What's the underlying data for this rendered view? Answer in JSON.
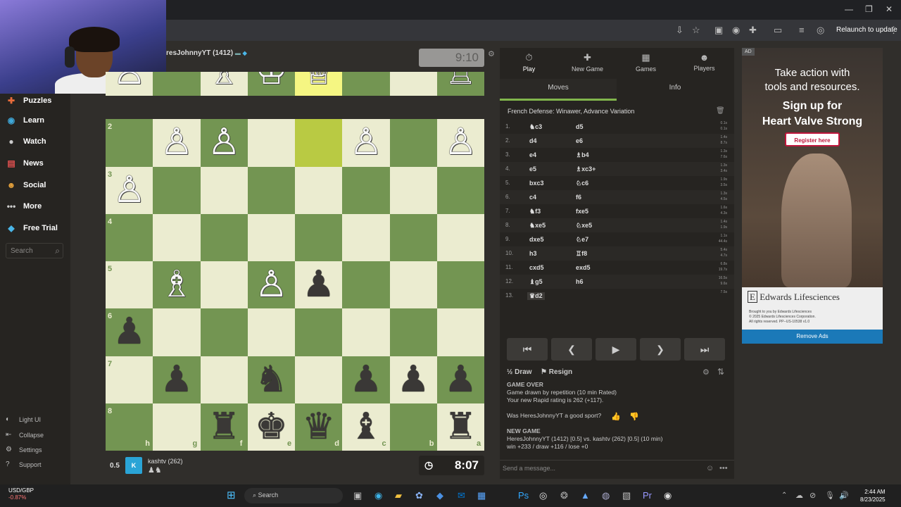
{
  "browser": {
    "relaunch_label": "Relaunch to update"
  },
  "sidebar": {
    "items": [
      {
        "icon": "puzzle-icon",
        "glyph": "✚",
        "label": "Puzzles",
        "color": "#e96c3b"
      },
      {
        "icon": "learn-icon",
        "glyph": "◉",
        "label": "Learn",
        "color": "#3fa8d9"
      },
      {
        "icon": "watch-icon",
        "glyph": "●",
        "label": "Watch",
        "color": "#cccccc"
      },
      {
        "icon": "news-icon",
        "glyph": "▤",
        "label": "News",
        "color": "#e0504f"
      },
      {
        "icon": "social-icon",
        "glyph": "☻",
        "label": "Social",
        "color": "#e6a23c"
      },
      {
        "icon": "more-icon",
        "glyph": "•••",
        "label": "More",
        "color": "#cccccc"
      },
      {
        "icon": "diamond-icon",
        "glyph": "◆",
        "label": "Free Trial",
        "color": "#4ab6e8"
      }
    ],
    "search_placeholder": "Search",
    "bottom": [
      {
        "glyph": "◐",
        "label": "Light UI"
      },
      {
        "glyph": "⇤",
        "label": "Collapse"
      },
      {
        "glyph": "⚙",
        "label": "Settings"
      },
      {
        "glyph": "?",
        "label": "Support"
      }
    ]
  },
  "top_player": {
    "name": "resJohnnyYT (1412)",
    "clock": "9:10"
  },
  "bottom_player": {
    "score": "0.5",
    "name": "kashtv (262)",
    "clock": "8:07",
    "avatar": "K"
  },
  "board": {
    "light": "#ebecd0",
    "dark": "#739552",
    "highlight": [
      [
        0,
        4
      ],
      [
        1,
        4
      ]
    ],
    "ranks": [
      "1",
      "2",
      "3",
      "4",
      "5",
      "6",
      "7",
      "8"
    ],
    "files": [
      "h",
      "g",
      "f",
      "e",
      "d",
      "c",
      "b",
      "a"
    ],
    "pieces": [
      {
        "r": 0,
        "c": 0,
        "p": "♙",
        "s": "w"
      },
      {
        "r": 0,
        "c": 2,
        "p": "♗",
        "s": "w"
      },
      {
        "r": 0,
        "c": 3,
        "p": "♔",
        "s": "w"
      },
      {
        "r": 0,
        "c": 4,
        "p": "♕",
        "s": "w"
      },
      {
        "r": 0,
        "c": 7,
        "p": "♖",
        "s": "w"
      },
      {
        "r": 1,
        "c": 1,
        "p": "♙",
        "s": "w"
      },
      {
        "r": 1,
        "c": 2,
        "p": "♙",
        "s": "w"
      },
      {
        "r": 1,
        "c": 5,
        "p": "♙",
        "s": "w"
      },
      {
        "r": 1,
        "c": 7,
        "p": "♙",
        "s": "w"
      },
      {
        "r": 2,
        "c": 0,
        "p": "♙",
        "s": "w"
      },
      {
        "r": 4,
        "c": 1,
        "p": "♗",
        "s": "w"
      },
      {
        "r": 4,
        "c": 3,
        "p": "♙",
        "s": "w"
      },
      {
        "r": 4,
        "c": 4,
        "p": "♟",
        "s": "b"
      },
      {
        "r": 5,
        "c": 0,
        "p": "♟",
        "s": "b"
      },
      {
        "r": 6,
        "c": 1,
        "p": "♟",
        "s": "b"
      },
      {
        "r": 6,
        "c": 3,
        "p": "♞",
        "s": "b"
      },
      {
        "r": 6,
        "c": 5,
        "p": "♟",
        "s": "b"
      },
      {
        "r": 6,
        "c": 6,
        "p": "♟",
        "s": "b"
      },
      {
        "r": 6,
        "c": 7,
        "p": "♟",
        "s": "b"
      },
      {
        "r": 7,
        "c": 2,
        "p": "♜",
        "s": "b"
      },
      {
        "r": 7,
        "c": 3,
        "p": "♚",
        "s": "b"
      },
      {
        "r": 7,
        "c": 4,
        "p": "♛",
        "s": "b"
      },
      {
        "r": 7,
        "c": 5,
        "p": "♝",
        "s": "b"
      },
      {
        "r": 7,
        "c": 7,
        "p": "♜",
        "s": "b"
      }
    ]
  },
  "panel": {
    "tabs": [
      {
        "glyph": "⏱",
        "label": "Play"
      },
      {
        "glyph": "✚",
        "label": "New Game"
      },
      {
        "glyph": "▦",
        "label": "Games"
      },
      {
        "glyph": "☻",
        "label": "Players"
      }
    ],
    "subtabs": [
      "Moves",
      "Info"
    ],
    "opening": "French Defense: Winawer, Advance Variation",
    "moves": [
      {
        "n": "1.",
        "w": "♞c3",
        "b": "d5",
        "t": [
          "0.1s",
          "0.1s"
        ]
      },
      {
        "n": "2.",
        "w": "d4",
        "b": "e6",
        "t": [
          "1.4s",
          "8.7s"
        ]
      },
      {
        "n": "3.",
        "w": "e4",
        "b": "♗b4",
        "t": [
          "1.3s",
          "7.6s"
        ]
      },
      {
        "n": "4.",
        "w": "e5",
        "b": "♗xc3+",
        "t": [
          "1.3s",
          "3.4s"
        ]
      },
      {
        "n": "5.",
        "w": "bxc3",
        "b": "♘c6",
        "t": [
          "1.9s",
          "3.5s"
        ]
      },
      {
        "n": "6.",
        "w": "c4",
        "b": "f6",
        "t": [
          "1.3s",
          "4.5s"
        ]
      },
      {
        "n": "7.",
        "w": "♞f3",
        "b": "fxe5",
        "t": [
          "1.6s",
          "4.3s"
        ]
      },
      {
        "n": "8.",
        "w": "♞xe5",
        "b": "♘xe5",
        "t": [
          "1.4s",
          "1.9s"
        ]
      },
      {
        "n": "9.",
        "w": "dxe5",
        "b": "♘e7",
        "t": [
          "1.1s",
          "44.4s"
        ]
      },
      {
        "n": "10.",
        "w": "h3",
        "b": "♖f8",
        "t": [
          "5.4s",
          "4.7s"
        ]
      },
      {
        "n": "11.",
        "w": "cxd5",
        "b": "exd5",
        "t": [
          "6.8s",
          "19.7s"
        ]
      },
      {
        "n": "12.",
        "w": "♝g5",
        "b": "h6",
        "t": [
          "16.5s",
          "9.6s"
        ]
      },
      {
        "n": "13.",
        "w": "♛d2",
        "b": "",
        "t": [
          "7.5s",
          ""
        ]
      }
    ],
    "nav": [
      "⏮",
      "❮",
      "▶",
      "❯",
      "⏭"
    ],
    "draw_label": "Draw",
    "resign_label": "Resign",
    "chat": [
      {
        "text": "GAME OVER",
        "h": true
      },
      {
        "text": "Game drawn by repetition (10 min Rated)"
      },
      {
        "text": "Your new Rapid rating is 262 (+117)."
      },
      {
        "text": ""
      },
      {
        "text": "Was HeresJohnnyYT a good sport?"
      },
      {
        "text": ""
      },
      {
        "text": "NEW GAME",
        "h": true
      },
      {
        "text": "HeresJohnnyYT (1412) [0.5] vs. kashtv (262) [0.5] (10 min)"
      },
      {
        "text": "win +233 / draw +116 / lose +0"
      }
    ],
    "message_placeholder": "Send a message..."
  },
  "ad": {
    "tag": "AD",
    "line1": "Take action with",
    "line2": "tools and resources.",
    "line3": "Sign up for",
    "line4": "Heart Valve Strong",
    "button": "Register here",
    "brand": "Edwards Lifesciences",
    "fine1": "Brought to you by Edwards Lifesciences",
    "fine2": "© 2025 Edwards Lifesciences Corporation.",
    "fine3": "All rights reserved. PP--US-10538 v1.0",
    "remove": "Remove Ads"
  },
  "taskbar": {
    "currency": "USD/GBP",
    "change": "-0.87%",
    "search": "Search",
    "time": "2:44 AM",
    "date": "8/23/2025"
  }
}
